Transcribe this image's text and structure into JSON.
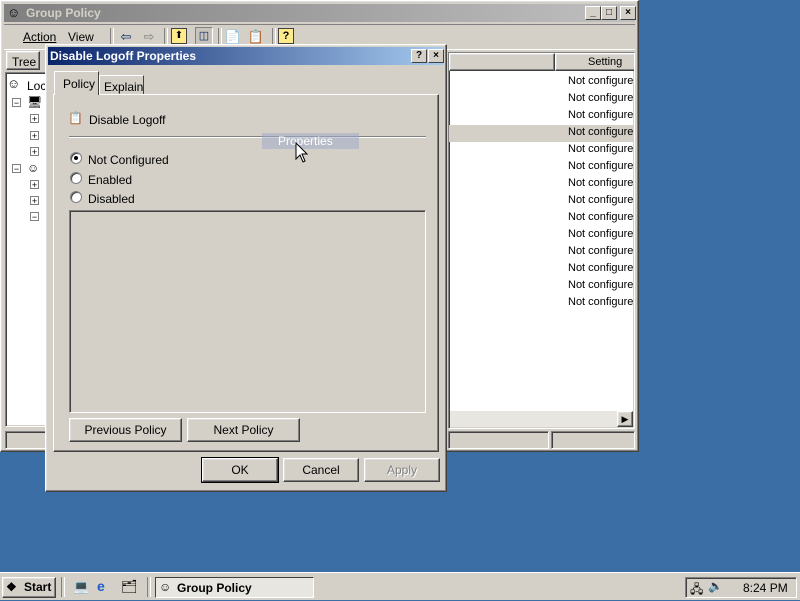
{
  "main_window": {
    "title": "Group Policy",
    "menu": [
      "Action",
      "View"
    ],
    "tree_tab": "Tree",
    "tree_root_label": "Loc",
    "column_header": "Setting",
    "settings": [
      "Not configure",
      "Not configure",
      "Not configure",
      "Not configure",
      "Not configure",
      "Not configure",
      "Not configure",
      "Not configure",
      "Not configure",
      "Not configure",
      "Not configure",
      "Not configure",
      "Not configure",
      "Not configure"
    ]
  },
  "dialog": {
    "title": "Disable Logoff Properties",
    "help_button": "?",
    "close_button": "×",
    "tabs": [
      "Policy",
      "Explain"
    ],
    "policy_name": "Disable Logoff",
    "options": [
      "Not Configured",
      "Enabled",
      "Disabled"
    ],
    "selected_option": "Not Configured",
    "previous_policy": "Previous Policy",
    "next_policy": "Next Policy",
    "ok": "OK",
    "cancel": "Cancel",
    "apply": "Apply"
  },
  "drag_ghost": "Properties",
  "taskbar": {
    "start": "Start",
    "task": "Group Policy",
    "clock": "8:24 PM"
  },
  "colors": {
    "desktop": "#3a6ea5",
    "title_active": "#0a246a",
    "face": "#d4d0c8"
  }
}
